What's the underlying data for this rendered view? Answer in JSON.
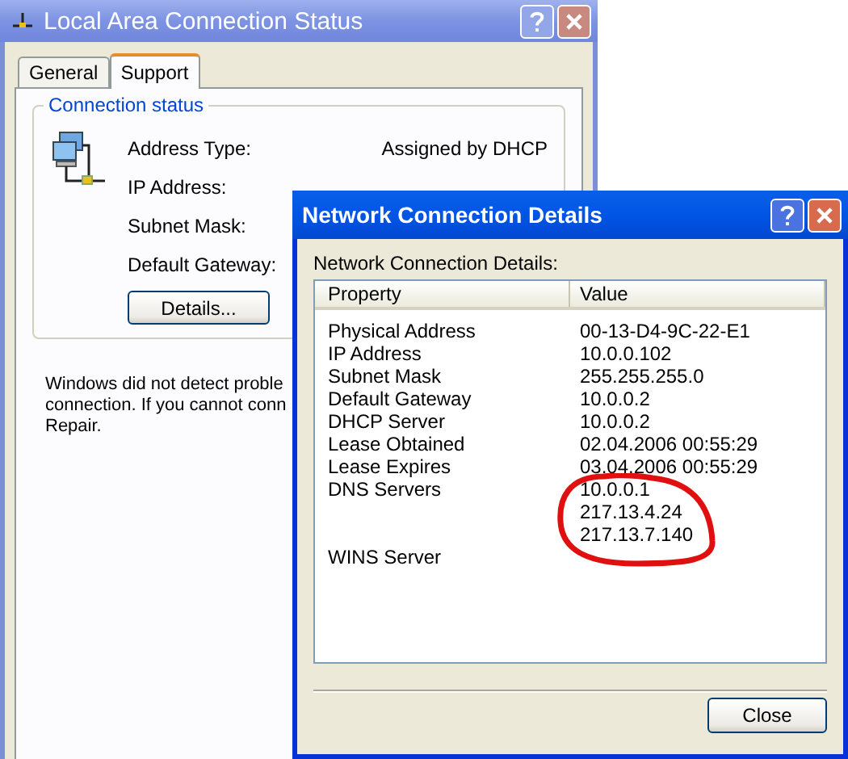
{
  "status_window": {
    "title": "Local Area Connection Status",
    "tabs": [
      {
        "label": "General",
        "selected": false
      },
      {
        "label": "Support",
        "selected": true
      }
    ],
    "group": {
      "title": "Connection status",
      "rows": [
        {
          "label": "Address Type:",
          "value": "Assigned by DHCP"
        },
        {
          "label": "IP Address:"
        },
        {
          "label": "Subnet Mask:"
        },
        {
          "label": "Default Gateway:"
        }
      ]
    },
    "details_button": "Details...",
    "message_lines": [
      "Windows did not detect proble",
      "connection. If you cannot conn",
      "Repair."
    ]
  },
  "details_window": {
    "title": "Network Connection Details",
    "label": "Network Connection Details:",
    "columns": [
      "Property",
      "Value"
    ],
    "rows": [
      {
        "property": "Physical Address",
        "values": [
          "00-13-D4-9C-22-E1"
        ]
      },
      {
        "property": "IP Address",
        "values": [
          "10.0.0.102"
        ]
      },
      {
        "property": "Subnet Mask",
        "values": [
          "255.255.255.0"
        ]
      },
      {
        "property": "Default Gateway",
        "values": [
          "10.0.0.2"
        ]
      },
      {
        "property": "DHCP Server",
        "values": [
          "10.0.0.2"
        ]
      },
      {
        "property": "Lease Obtained",
        "values": [
          "02.04.2006 00:55:29"
        ]
      },
      {
        "property": "Lease Expires",
        "values": [
          "03.04.2006 00:55:29"
        ]
      },
      {
        "property": "DNS Servers",
        "values": [
          "10.0.0.1",
          "217.13.4.24",
          "217.13.7.140"
        ]
      },
      {
        "property": "WINS Server",
        "values": []
      }
    ],
    "close_button": "Close"
  }
}
